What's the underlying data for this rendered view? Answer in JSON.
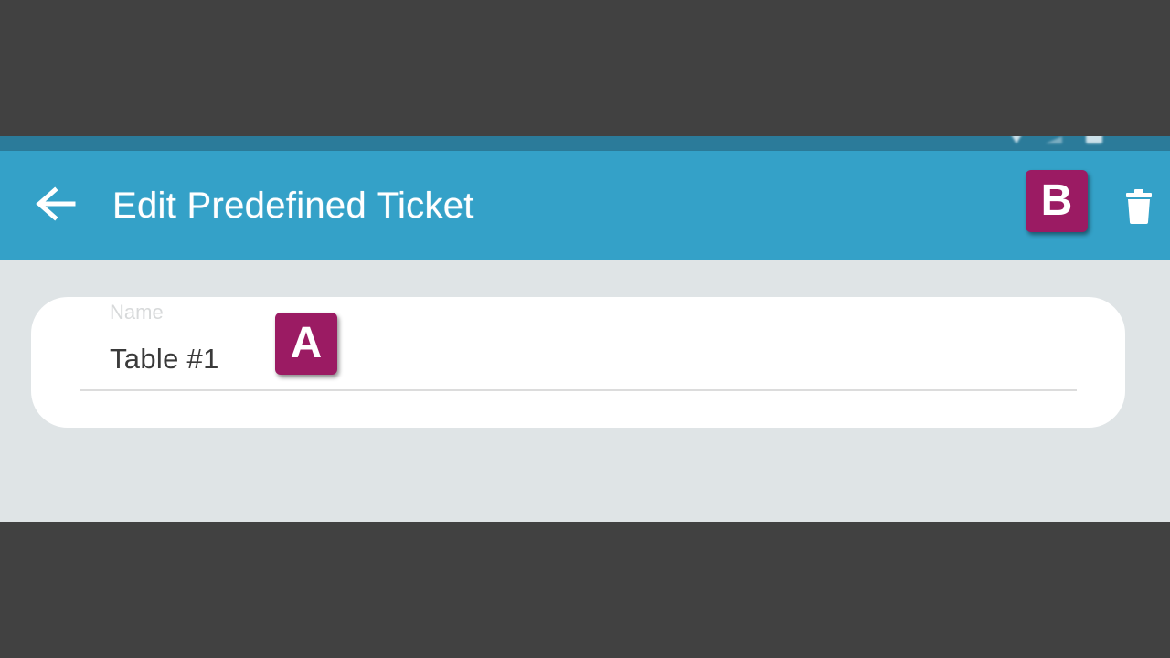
{
  "app_bar": {
    "title": "Edit Predefined Ticket",
    "back_icon": "arrow-left-icon",
    "delete_icon": "trash-icon"
  },
  "form": {
    "name_label": "Name",
    "name_value": "Table #1"
  },
  "markers": {
    "a": "A",
    "b": "B"
  },
  "colors": {
    "app_bar": "#34a1c8",
    "status_bar": "#2b7b9a",
    "background": "#dfe4e6",
    "marker": "#9b1b63",
    "letterbox": "#414141"
  }
}
